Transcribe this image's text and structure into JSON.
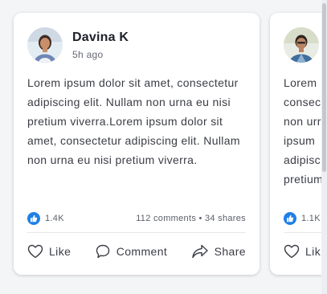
{
  "posts": [
    {
      "author": "Davina K",
      "time": "5h ago",
      "text": "Lorem ipsum dolor sit amet, consectetur adipiscing elit. Nullam non urna eu nisi pretium viverra.Lorem ipsum dolor sit amet, consectetur adipiscing elit. Nullam non urna eu nisi pretium viverra.",
      "likes": "1.4K",
      "engagement": "112 comments • 34 shares",
      "actions": {
        "like": "Like",
        "comment": "Comment",
        "share": "Share"
      }
    },
    {
      "author": "",
      "time": "",
      "text_lines": [
        "Lorem",
        "consec",
        "non urr",
        "ipsum",
        "adipisc",
        "pretium"
      ],
      "likes": "1.1K",
      "actions": {
        "like": "Lik"
      }
    }
  ],
  "colors": {
    "accent": "#1f7fe6",
    "card": "#ffffff",
    "background": "#f4f5f7",
    "text": "#3b3d45"
  },
  "icons": {
    "like_badge": "thumbs-up-icon",
    "like": "heart-icon",
    "comment": "comment-bubble-icon",
    "share": "share-arrow-icon"
  }
}
